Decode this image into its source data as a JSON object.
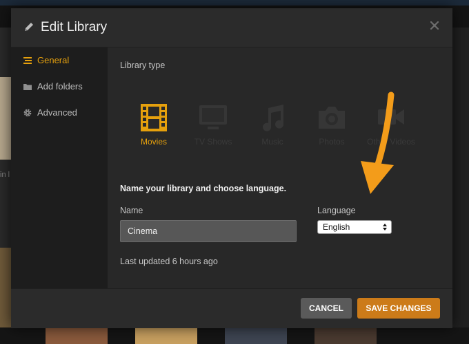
{
  "background": {
    "left_text": "in l"
  },
  "modal": {
    "title": "Edit Library",
    "sidebar": [
      {
        "label": "General",
        "icon": "list-icon",
        "active": true
      },
      {
        "label": "Add folders",
        "icon": "folder-icon",
        "active": false
      },
      {
        "label": "Advanced",
        "icon": "gear-icon",
        "active": false
      }
    ],
    "library_type_label": "Library type",
    "library_types": [
      {
        "label": "Movies",
        "icon": "film-icon",
        "selected": true
      },
      {
        "label": "TV Shows",
        "icon": "tv-icon",
        "selected": false
      },
      {
        "label": "Music",
        "icon": "music-note-icon",
        "selected": false
      },
      {
        "label": "Photos",
        "icon": "camera-icon",
        "selected": false
      },
      {
        "label": "Other Videos",
        "icon": "video-camera-icon",
        "selected": false
      }
    ],
    "name_heading": "Name your library and choose language.",
    "name_label": "Name",
    "name_value": "Cinema",
    "language_label": "Language",
    "language_value": "English",
    "last_updated": "Last updated 6 hours ago",
    "buttons": {
      "cancel": "CANCEL",
      "save": "SAVE CHANGES"
    }
  },
  "colors": {
    "accent": "#e5a00d",
    "save_button": "#cc7b19",
    "cancel_button": "#5a5a5a",
    "arrow": "#f39c1a"
  }
}
